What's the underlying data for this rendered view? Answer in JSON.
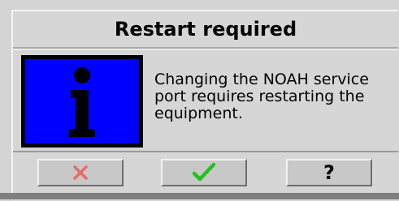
{
  "dialog": {
    "title": "Restart required",
    "message": "Changing the NOAH service port requires restarting the equipment.",
    "icon": "info-icon"
  },
  "buttons": {
    "cancel_icon": "x-icon",
    "ok_icon": "checkmark-icon",
    "help_label": "?"
  },
  "colors": {
    "info_background": "#0000ff",
    "cancel_x": "#e86a6a",
    "ok_check": "#22c21e"
  }
}
